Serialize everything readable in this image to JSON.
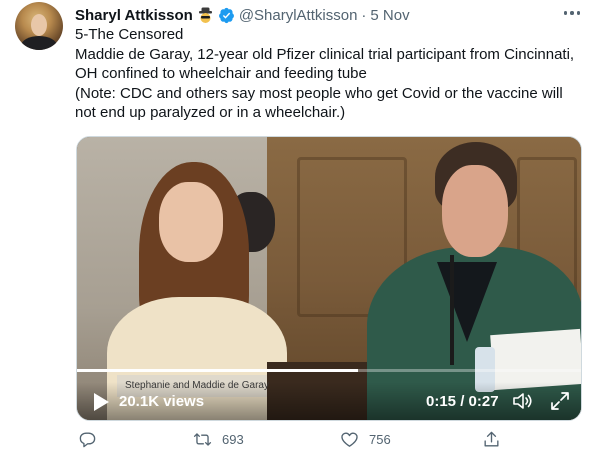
{
  "tweet": {
    "author_name": "Sharyl Attkisson",
    "author_emoji": "spy-emoji-icon",
    "verified": "verified-badge-icon",
    "handle": "@SharylAttkisson",
    "separator": "·",
    "date": "5 Nov",
    "text_lines": [
      "5-The Censored",
      "Maddie de Garay, 12-year old Pfizer clinical trial participant from Cincinnati,",
      "OH confined to wheelchair and feeding tube",
      "(Note: CDC and others say most people who get Covid or the vaccine will",
      "not end up paralyzed or in a wheelchair.)"
    ]
  },
  "video": {
    "nameplate": "Stephanie and Maddie de Garay",
    "views": "20.1K views",
    "timecode": "0:15 / 0:27",
    "progress": 0.556,
    "icons": [
      "play-icon",
      "volume-icon",
      "fullscreen-icon"
    ]
  },
  "actions": {
    "retweets": "693",
    "likes": "756",
    "icons": [
      "reply-icon",
      "retweet-icon",
      "like-icon",
      "share-icon"
    ]
  },
  "colors": {
    "text": "#0f1419",
    "secondary": "#536471",
    "verified": "#1d9bf0",
    "background": "#ffffff"
  }
}
